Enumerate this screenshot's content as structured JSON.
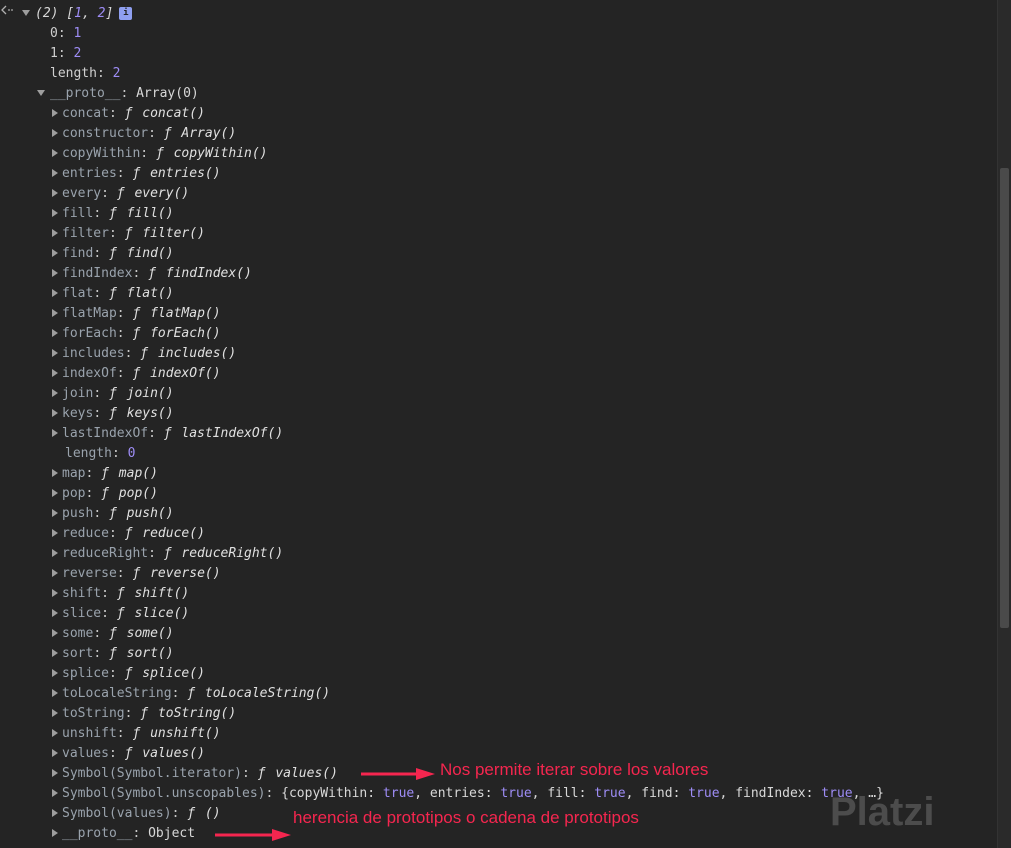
{
  "header": {
    "summary": "(2) [1, 2]",
    "info": "i"
  },
  "items": [
    {
      "key": "0",
      "value": "1"
    },
    {
      "key": "1",
      "value": "2"
    },
    {
      "key": "length",
      "value": "2"
    }
  ],
  "proto": {
    "key": "__proto__",
    "value": "Array(0)"
  },
  "methods": [
    {
      "key": "concat",
      "value": "concat()"
    },
    {
      "key": "constructor",
      "value": "Array()"
    },
    {
      "key": "copyWithin",
      "value": "copyWithin()"
    },
    {
      "key": "entries",
      "value": "entries()"
    },
    {
      "key": "every",
      "value": "every()"
    },
    {
      "key": "fill",
      "value": "fill()"
    },
    {
      "key": "filter",
      "value": "filter()"
    },
    {
      "key": "find",
      "value": "find()"
    },
    {
      "key": "findIndex",
      "value": "findIndex()"
    },
    {
      "key": "flat",
      "value": "flat()"
    },
    {
      "key": "flatMap",
      "value": "flatMap()"
    },
    {
      "key": "forEach",
      "value": "forEach()"
    },
    {
      "key": "includes",
      "value": "includes()"
    },
    {
      "key": "indexOf",
      "value": "indexOf()"
    },
    {
      "key": "join",
      "value": "join()"
    },
    {
      "key": "keys",
      "value": "keys()"
    },
    {
      "key": "lastIndexOf",
      "value": "lastIndexOf()"
    }
  ],
  "proto_length": {
    "key": "length",
    "value": "0"
  },
  "methods2": [
    {
      "key": "map",
      "value": "map()"
    },
    {
      "key": "pop",
      "value": "pop()"
    },
    {
      "key": "push",
      "value": "push()"
    },
    {
      "key": "reduce",
      "value": "reduce()"
    },
    {
      "key": "reduceRight",
      "value": "reduceRight()"
    },
    {
      "key": "reverse",
      "value": "reverse()"
    },
    {
      "key": "shift",
      "value": "shift()"
    },
    {
      "key": "slice",
      "value": "slice()"
    },
    {
      "key": "some",
      "value": "some()"
    },
    {
      "key": "sort",
      "value": "sort()"
    },
    {
      "key": "splice",
      "value": "splice()"
    },
    {
      "key": "toLocaleString",
      "value": "toLocaleString()"
    },
    {
      "key": "toString",
      "value": "toString()"
    },
    {
      "key": "unshift",
      "value": "unshift()"
    },
    {
      "key": "values",
      "value": "values()"
    }
  ],
  "symbol_iterator": {
    "key": "Symbol(Symbol.iterator)",
    "value": "values()"
  },
  "symbol_unscopables": {
    "key": "Symbol(Symbol.unscopables)",
    "open": "{",
    "pairs": [
      {
        "k": "copyWithin",
        "v": "true"
      },
      {
        "k": "entries",
        "v": "true"
      },
      {
        "k": "fill",
        "v": "true"
      },
      {
        "k": "find",
        "v": "true"
      },
      {
        "k": "findIndex",
        "v": "true"
      }
    ],
    "tail": ", …}"
  },
  "symbol_values": {
    "key": "Symbol(values)",
    "value": "()"
  },
  "object_proto": {
    "key": "__proto__",
    "value": "Object"
  },
  "fn_glyph": "ƒ",
  "annotations": {
    "iterator_note": "Nos permite iterar sobre los valores",
    "proto_note": "herencia de prototipos o cadena de prototipos",
    "color": "#f5264f"
  },
  "watermark": "Platzi"
}
